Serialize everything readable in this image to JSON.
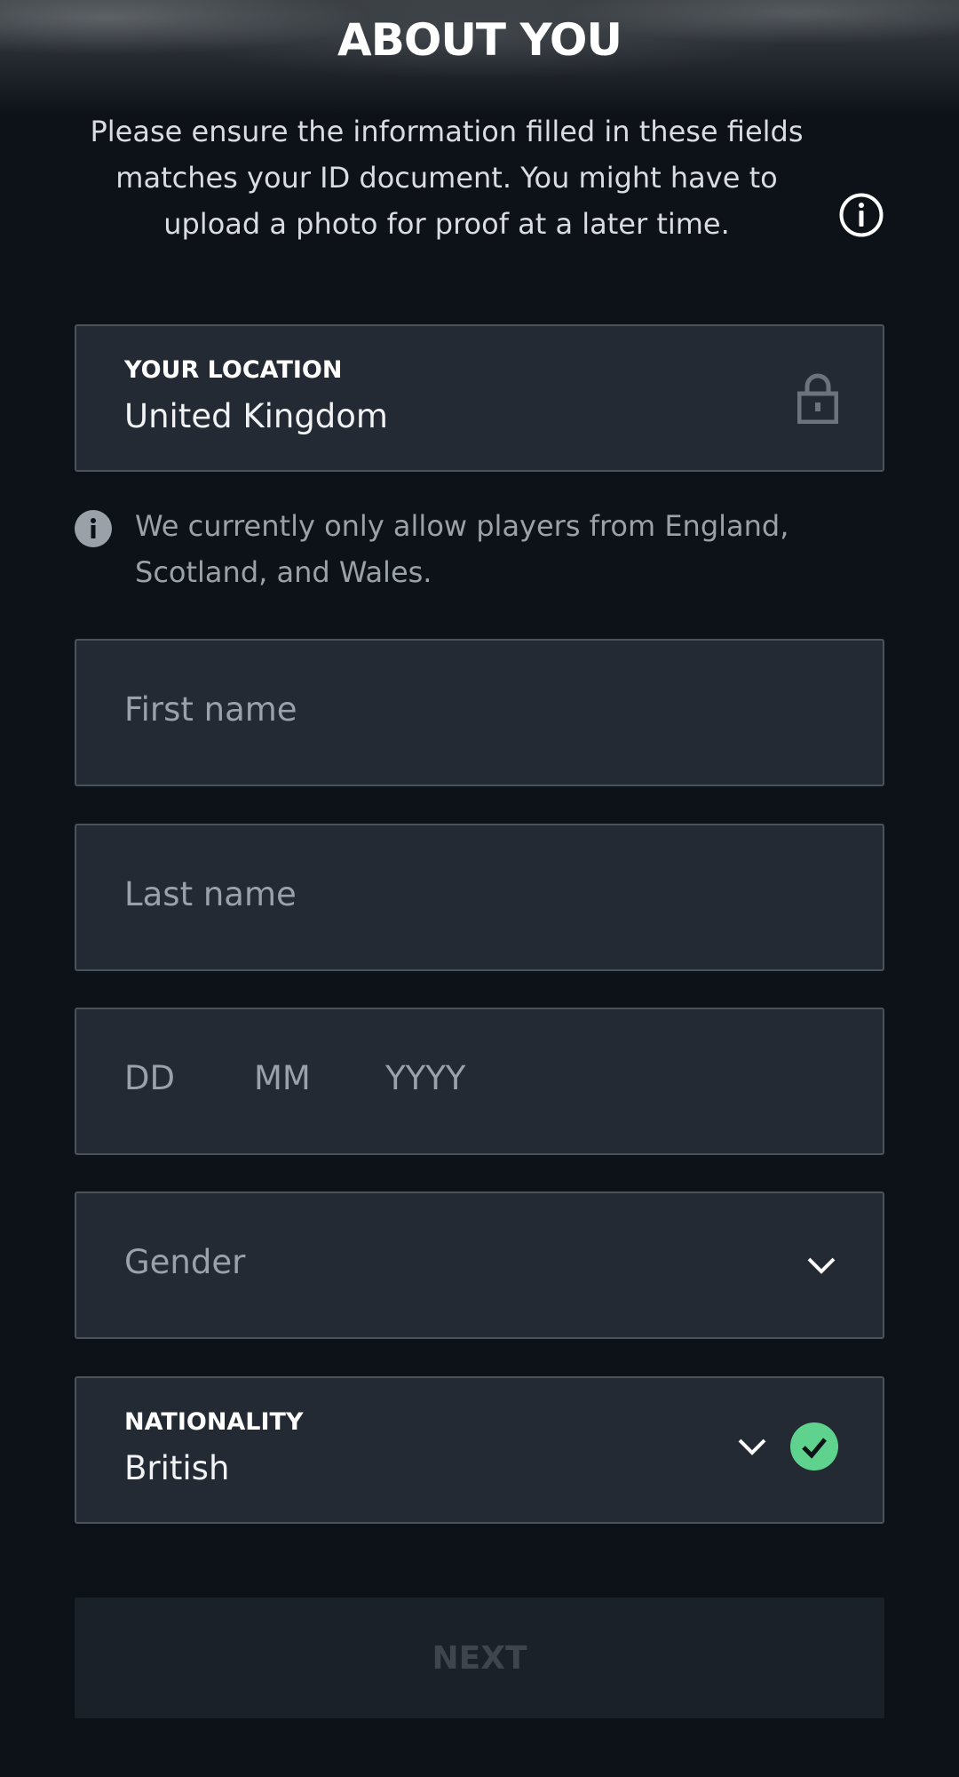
{
  "header": {
    "title": "ABOUT YOU"
  },
  "intro": {
    "text": "Please ensure the information filled in these fields matches your ID document. You might have to upload a photo for proof at a later time.",
    "info_icon": "info-circle-icon"
  },
  "location": {
    "label": "YOUR LOCATION",
    "value": "United Kingdom",
    "icon": "lock-icon"
  },
  "notice": {
    "icon": "info-filled-icon",
    "text": "We currently only allow players from England, Scotland, and Wales."
  },
  "first_name": {
    "placeholder": "First name",
    "value": ""
  },
  "last_name": {
    "placeholder": "Last name",
    "value": ""
  },
  "date_of_birth": {
    "day_placeholder": "DD",
    "month_placeholder": "MM",
    "year_placeholder": "YYYY"
  },
  "gender": {
    "placeholder": "Gender",
    "icon": "chevron-down-icon"
  },
  "nationality": {
    "label": "NATIONALITY",
    "value": "British",
    "icons": [
      "chevron-down-icon",
      "check-circle-icon"
    ]
  },
  "next_button": {
    "label": "NEXT"
  },
  "colors": {
    "background": "#0d1218",
    "field_background": "#232a33",
    "field_border": "#4a525b",
    "placeholder": "#9aa1a8",
    "success": "#5fd38d",
    "button_disabled_bg": "#1b2128",
    "button_disabled_text": "#3e454d"
  }
}
